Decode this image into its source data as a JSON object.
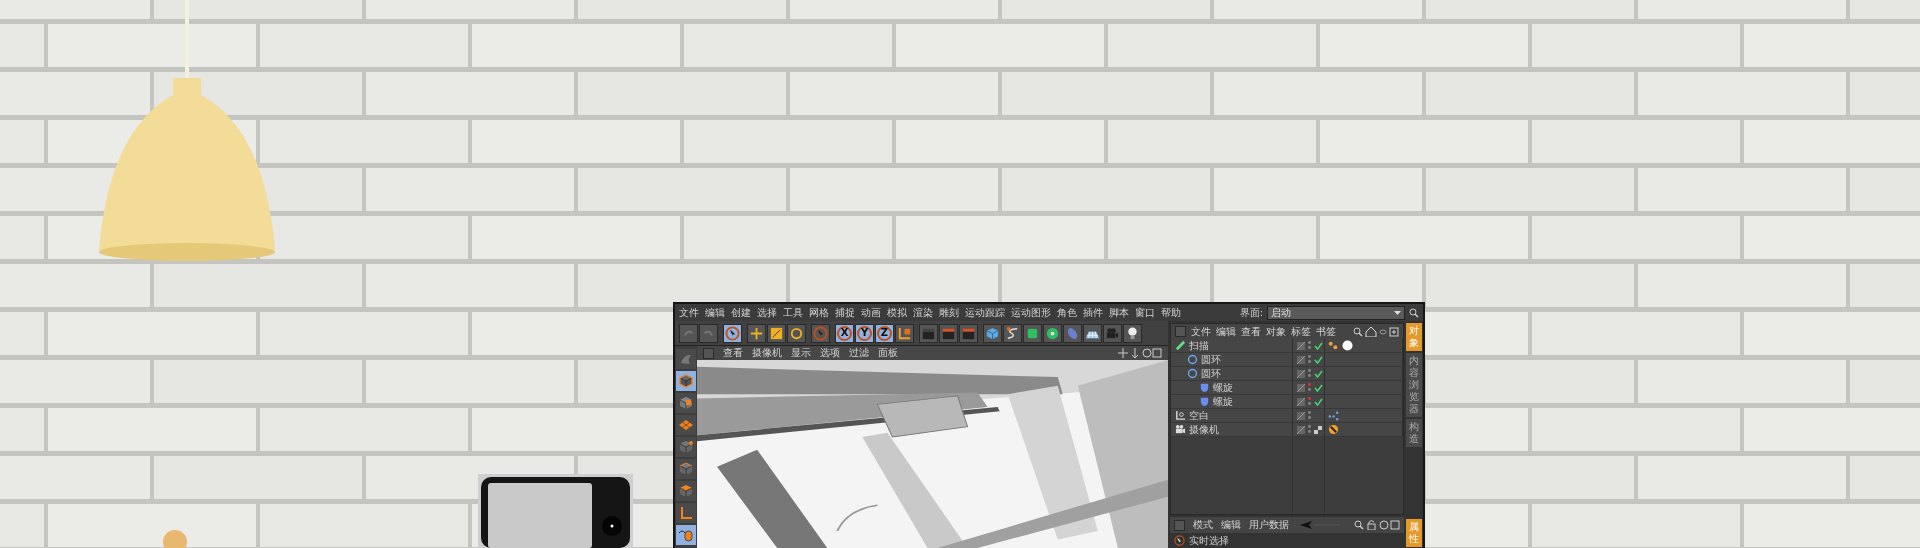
{
  "app": {
    "menu": [
      "文件",
      "编辑",
      "创建",
      "选择",
      "工具",
      "网格",
      "捕捉",
      "动画",
      "模拟",
      "渲染",
      "雕刻",
      "运动跟踪",
      "运动图形",
      "角色",
      "插件",
      "脚本",
      "窗口",
      "帮助"
    ],
    "layout": {
      "label": "界面:",
      "value": "启动"
    },
    "toolbar": [
      {
        "kind": "undo",
        "selected": false
      },
      {
        "kind": "redo",
        "selected": false
      },
      {
        "kind": "select",
        "selected": true
      },
      {
        "kind": "move",
        "selected": false
      },
      {
        "kind": "scale",
        "selected": false
      },
      {
        "kind": "rotate",
        "selected": false
      },
      {
        "kind": "recent",
        "selected": false
      },
      {
        "kind": "axis",
        "label": "X",
        "selected": true
      },
      {
        "kind": "axis",
        "label": "Y",
        "selected": true
      },
      {
        "kind": "axis",
        "label": "Z",
        "selected": true
      },
      {
        "kind": "coord",
        "selected": false
      },
      {
        "kind": "render-view",
        "selected": false
      },
      {
        "kind": "render",
        "selected": false
      },
      {
        "kind": "render-settings",
        "selected": false
      },
      {
        "kind": "cube",
        "selected": false
      },
      {
        "kind": "pen",
        "selected": false
      },
      {
        "kind": "subdivision",
        "selected": false
      },
      {
        "kind": "cloner",
        "selected": false
      },
      {
        "kind": "deformer",
        "selected": false
      },
      {
        "kind": "floor",
        "selected": false
      },
      {
        "kind": "camera",
        "selected": false
      },
      {
        "kind": "light",
        "selected": false
      }
    ],
    "tool_column": [
      {
        "kind": "sculpt",
        "selected": false
      },
      {
        "kind": "model",
        "selected": true
      },
      {
        "kind": "texture",
        "selected": false
      },
      {
        "kind": "workplane",
        "selected": false
      },
      {
        "kind": "points",
        "selected": false
      },
      {
        "kind": "edges",
        "selected": false
      },
      {
        "kind": "polygons",
        "selected": false
      },
      {
        "kind": "axis",
        "selected": false
      },
      {
        "kind": "tweak",
        "selected": true
      }
    ],
    "viewport": {
      "menu": [
        "查看",
        "摄像机",
        "显示",
        "选项",
        "过滤",
        "面板"
      ]
    },
    "object_manager": {
      "menu": [
        "文件",
        "编辑",
        "查看",
        "对象",
        "标签",
        "书签"
      ],
      "objects": [
        {
          "name": "扫描",
          "kind": "sweep",
          "checked": true,
          "hidden": false,
          "tags": [
            {
              "kind": "phong"
            },
            {
              "kind": "material"
            }
          ],
          "children": [
            {
              "name": "圆环",
              "kind": "circle",
              "checked": true,
              "hidden": false
            },
            {
              "name": "圆环",
              "kind": "circle",
              "checked": true,
              "hidden": false,
              "children": [
                {
                  "name": "螺旋",
                  "kind": "helix",
                  "checked": true,
                  "hidden": true
                },
                {
                  "name": "螺旋",
                  "kind": "helix",
                  "checked": true,
                  "hidden": true
                }
              ]
            }
          ]
        },
        {
          "name": "空白",
          "kind": "null",
          "checked": false,
          "hidden": false,
          "tags": [
            {
              "kind": "xpresso"
            }
          ]
        },
        {
          "name": "摄像机",
          "kind": "camera",
          "checked": false,
          "hidden": false,
          "tags": [
            {
              "kind": "protection"
            }
          ]
        }
      ]
    },
    "side_tabs": [
      {
        "label": "对象",
        "selected": true
      },
      {
        "label": "内容浏览器",
        "selected": false
      },
      {
        "label": "构造",
        "selected": false
      }
    ],
    "attributes": {
      "menu": [
        "模式",
        "编辑",
        "用户数据"
      ],
      "tool": "实时选择",
      "side_tabs": [
        {
          "label": "属性",
          "selected": true
        }
      ]
    }
  }
}
